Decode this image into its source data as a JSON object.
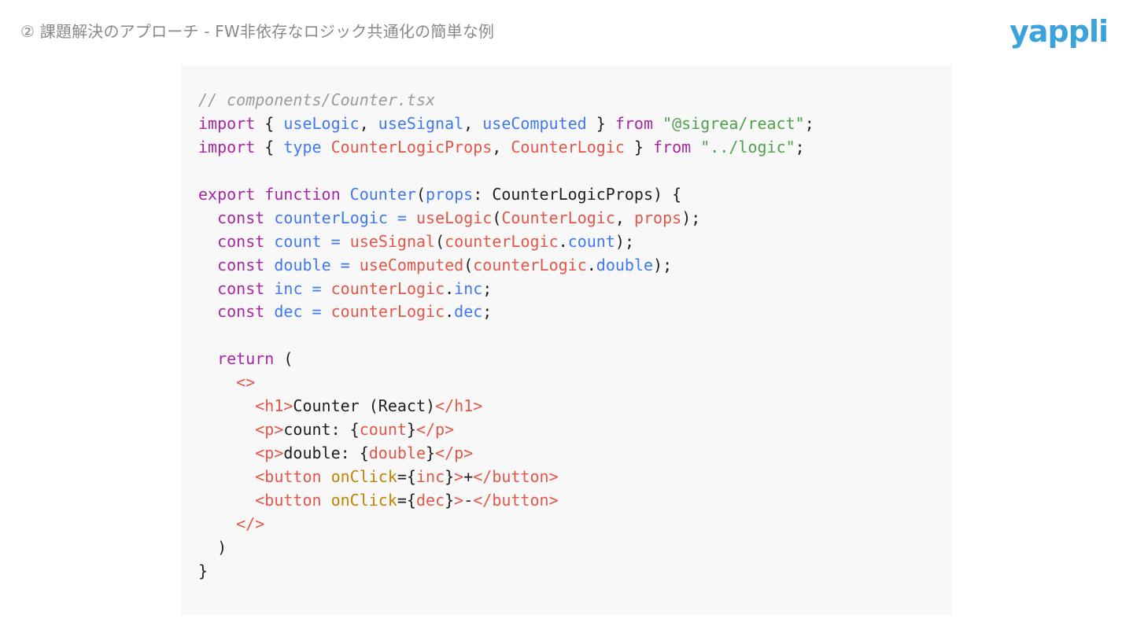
{
  "header": {
    "title": "② 課題解決のアプローチ  -  FW非依存なロジック共通化の簡単な例",
    "logo_text": "yappli"
  },
  "colors": {
    "comment": "#9b9b9b",
    "keyword": "#a626a4",
    "function": "#4078f2",
    "type": "#e45649",
    "string": "#50a14f",
    "variable": "#e45649",
    "property": "#4078f2",
    "tag": "#e45649",
    "attribute": "#c18401",
    "logo": "#3aa3dc",
    "panel_bg": "#f8f8f8"
  },
  "code": {
    "filename_comment": "// components/Counter.tsx",
    "lines": [
      [
        [
          "c-comment",
          "// components/Counter.tsx"
        ]
      ],
      [
        [
          "c-kw",
          "import"
        ],
        [
          "c-plain",
          " { "
        ],
        [
          "c-fn",
          "useLogic"
        ],
        [
          "c-plain",
          ", "
        ],
        [
          "c-fn",
          "useSignal"
        ],
        [
          "c-plain",
          ", "
        ],
        [
          "c-fn",
          "useComputed"
        ],
        [
          "c-plain",
          " } "
        ],
        [
          "c-kw",
          "from"
        ],
        [
          "c-plain",
          " "
        ],
        [
          "c-str",
          "\"@sigrea/react\""
        ],
        [
          "c-plain",
          ";"
        ]
      ],
      [
        [
          "c-kw",
          "import"
        ],
        [
          "c-plain",
          " { "
        ],
        [
          "c-fn",
          "type"
        ],
        [
          "c-plain",
          " "
        ],
        [
          "c-type",
          "CounterLogicProps"
        ],
        [
          "c-plain",
          ", "
        ],
        [
          "c-type",
          "CounterLogic"
        ],
        [
          "c-plain",
          " } "
        ],
        [
          "c-kw",
          "from"
        ],
        [
          "c-plain",
          " "
        ],
        [
          "c-str",
          "\"../logic\""
        ],
        [
          "c-plain",
          ";"
        ]
      ],
      [
        [
          "c-plain",
          ""
        ]
      ],
      [
        [
          "c-kw",
          "export"
        ],
        [
          "c-plain",
          " "
        ],
        [
          "c-kw",
          "function"
        ],
        [
          "c-plain",
          " "
        ],
        [
          "c-fn",
          "Counter"
        ],
        [
          "c-plain",
          "("
        ],
        [
          "c-prop",
          "props"
        ],
        [
          "c-plain",
          ": CounterLogicProps) {"
        ]
      ],
      [
        [
          "c-plain",
          "  "
        ],
        [
          "c-kw",
          "const"
        ],
        [
          "c-plain",
          " "
        ],
        [
          "c-fn",
          "counterLogic"
        ],
        [
          "c-plain",
          " "
        ],
        [
          "c-fn",
          "="
        ],
        [
          "c-plain",
          " "
        ],
        [
          "c-var",
          "useLogic"
        ],
        [
          "c-plain",
          "("
        ],
        [
          "c-type",
          "CounterLogic"
        ],
        [
          "c-plain",
          ", "
        ],
        [
          "c-var",
          "props"
        ],
        [
          "c-plain",
          ");"
        ]
      ],
      [
        [
          "c-plain",
          "  "
        ],
        [
          "c-kw",
          "const"
        ],
        [
          "c-plain",
          " "
        ],
        [
          "c-fn",
          "count"
        ],
        [
          "c-plain",
          " "
        ],
        [
          "c-fn",
          "="
        ],
        [
          "c-plain",
          " "
        ],
        [
          "c-var",
          "useSignal"
        ],
        [
          "c-plain",
          "("
        ],
        [
          "c-var",
          "counterLogic"
        ],
        [
          "c-plain",
          "."
        ],
        [
          "c-prop",
          "count"
        ],
        [
          "c-plain",
          ");"
        ]
      ],
      [
        [
          "c-plain",
          "  "
        ],
        [
          "c-kw",
          "const"
        ],
        [
          "c-plain",
          " "
        ],
        [
          "c-fn",
          "double"
        ],
        [
          "c-plain",
          " "
        ],
        [
          "c-fn",
          "="
        ],
        [
          "c-plain",
          " "
        ],
        [
          "c-var",
          "useComputed"
        ],
        [
          "c-plain",
          "("
        ],
        [
          "c-var",
          "counterLogic"
        ],
        [
          "c-plain",
          "."
        ],
        [
          "c-prop",
          "double"
        ],
        [
          "c-plain",
          ");"
        ]
      ],
      [
        [
          "c-plain",
          "  "
        ],
        [
          "c-kw",
          "const"
        ],
        [
          "c-plain",
          " "
        ],
        [
          "c-fn",
          "inc"
        ],
        [
          "c-plain",
          " "
        ],
        [
          "c-fn",
          "="
        ],
        [
          "c-plain",
          " "
        ],
        [
          "c-var",
          "counterLogic"
        ],
        [
          "c-plain",
          "."
        ],
        [
          "c-prop",
          "inc"
        ],
        [
          "c-plain",
          ";"
        ]
      ],
      [
        [
          "c-plain",
          "  "
        ],
        [
          "c-kw",
          "const"
        ],
        [
          "c-plain",
          " "
        ],
        [
          "c-fn",
          "dec"
        ],
        [
          "c-plain",
          " "
        ],
        [
          "c-fn",
          "="
        ],
        [
          "c-plain",
          " "
        ],
        [
          "c-var",
          "counterLogic"
        ],
        [
          "c-plain",
          "."
        ],
        [
          "c-prop",
          "dec"
        ],
        [
          "c-plain",
          ";"
        ]
      ],
      [
        [
          "c-plain",
          ""
        ]
      ],
      [
        [
          "c-plain",
          "  "
        ],
        [
          "c-kw",
          "return"
        ],
        [
          "c-plain",
          " ("
        ]
      ],
      [
        [
          "c-plain",
          "    "
        ],
        [
          "c-tag",
          "<>"
        ]
      ],
      [
        [
          "c-plain",
          "      "
        ],
        [
          "c-tag",
          "<h1>"
        ],
        [
          "c-plain",
          "Counter (React)"
        ],
        [
          "c-tag",
          "</h1>"
        ]
      ],
      [
        [
          "c-plain",
          "      "
        ],
        [
          "c-tag",
          "<p>"
        ],
        [
          "c-plain",
          "count: {"
        ],
        [
          "c-var",
          "count"
        ],
        [
          "c-plain",
          "}"
        ],
        [
          "c-tag",
          "</p>"
        ]
      ],
      [
        [
          "c-plain",
          "      "
        ],
        [
          "c-tag",
          "<p>"
        ],
        [
          "c-plain",
          "double: {"
        ],
        [
          "c-var",
          "double"
        ],
        [
          "c-plain",
          "}"
        ],
        [
          "c-tag",
          "</p>"
        ]
      ],
      [
        [
          "c-plain",
          "      "
        ],
        [
          "c-tag",
          "<button"
        ],
        [
          "c-plain",
          " "
        ],
        [
          "c-attr",
          "onClick"
        ],
        [
          "c-plain",
          "={"
        ],
        [
          "c-var",
          "inc"
        ],
        [
          "c-plain",
          "}"
        ],
        [
          "c-tag",
          ">"
        ],
        [
          "c-plain",
          "+"
        ],
        [
          "c-tag",
          "</button>"
        ]
      ],
      [
        [
          "c-plain",
          "      "
        ],
        [
          "c-tag",
          "<button"
        ],
        [
          "c-plain",
          " "
        ],
        [
          "c-attr",
          "onClick"
        ],
        [
          "c-plain",
          "={"
        ],
        [
          "c-var",
          "dec"
        ],
        [
          "c-plain",
          "}"
        ],
        [
          "c-tag",
          ">"
        ],
        [
          "c-plain",
          "-"
        ],
        [
          "c-tag",
          "</button>"
        ]
      ],
      [
        [
          "c-plain",
          "    "
        ],
        [
          "c-tag",
          "</>"
        ]
      ],
      [
        [
          "c-plain",
          "  )"
        ]
      ],
      [
        [
          "c-plain",
          "}"
        ]
      ]
    ]
  }
}
